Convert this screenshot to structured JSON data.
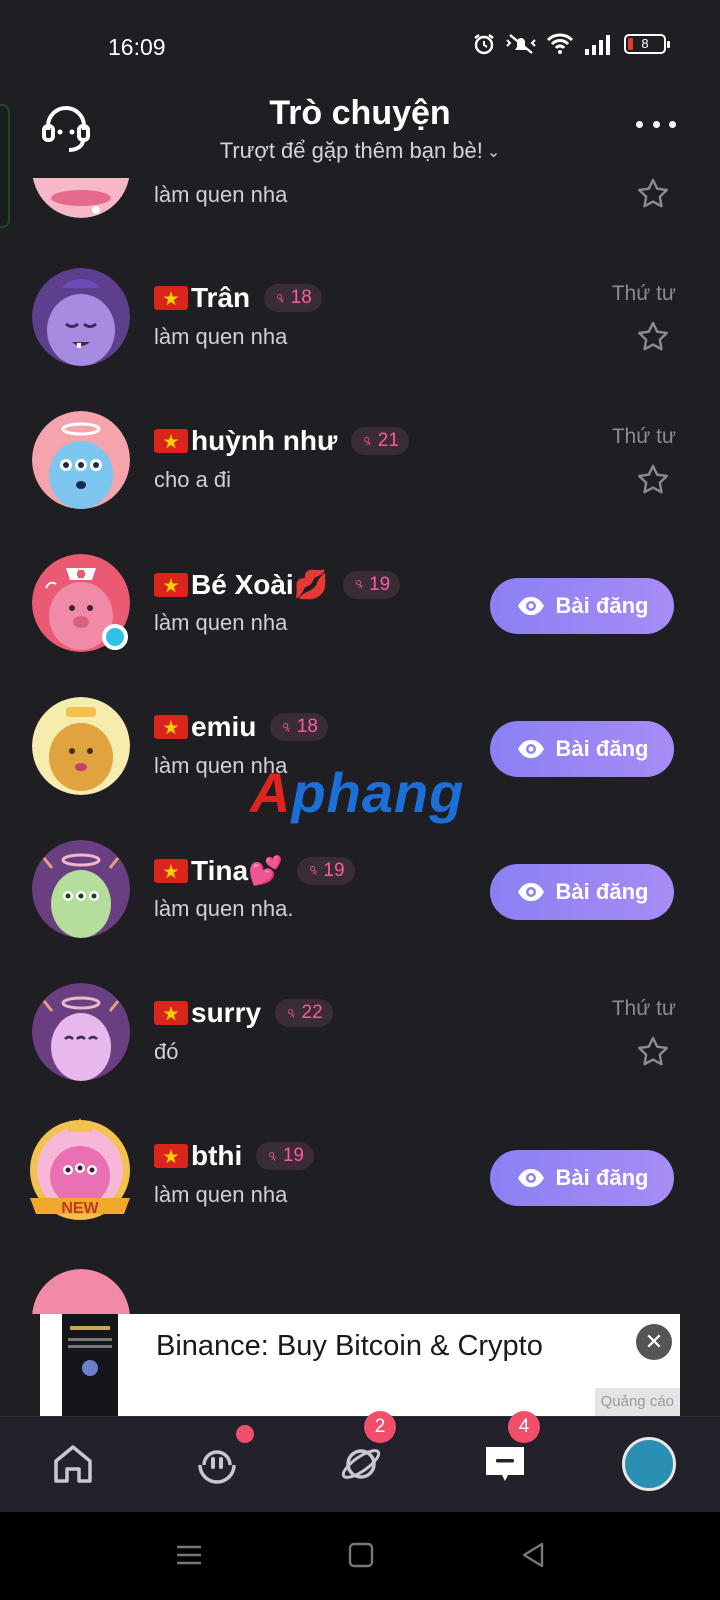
{
  "status_bar": {
    "time": "16:09",
    "battery": "8",
    "icons": [
      "alarm-icon",
      "mute-icon",
      "wifi-icon",
      "signal-icon",
      "battery-icon"
    ]
  },
  "header": {
    "title": "Trò chuyện",
    "subtitle": "Trượt để gặp thêm bạn bè!",
    "left_icon": "headset-support-icon",
    "right_icon": "more-icon"
  },
  "chats": [
    {
      "name": "",
      "age": "",
      "message": "làm quen nha",
      "time": "",
      "action": "star",
      "avatar": "pink-monster"
    },
    {
      "name": "Trân",
      "age": "18",
      "message": "làm quen nha",
      "time": "Thứ tư",
      "action": "star",
      "avatar": "purple-monster"
    },
    {
      "name": "huỳnh như",
      "age": "21",
      "message": "cho a đi",
      "time": "Thứ tư",
      "action": "star",
      "avatar": "blue-monster"
    },
    {
      "name": "Bé Xoài💋",
      "age": "19",
      "message": "làm quen nha",
      "time": "",
      "action": "post",
      "avatar": "pink-nurse-monster"
    },
    {
      "name": "emiu",
      "age": "18",
      "message": "làm quen nha",
      "time": "",
      "action": "post",
      "avatar": "orange-monster"
    },
    {
      "name": "Tina💕",
      "age": "19",
      "message": "làm quen nha.",
      "time": "",
      "action": "post",
      "avatar": "green-monster"
    },
    {
      "name": "surry",
      "age": "22",
      "message": "đó",
      "time": "Thứ tư",
      "action": "star",
      "avatar": "lilac-monster"
    },
    {
      "name": "bthi",
      "age": "19",
      "message": "làm quen nha",
      "time": "",
      "action": "post",
      "avatar": "pink-new-monster"
    }
  ],
  "labels": {
    "post_button": "Bài đăng",
    "new_badge": "NEW"
  },
  "watermark": {
    "part1": "A",
    "part2": "phang"
  },
  "ad": {
    "title": "Binance: Buy Bitcoin & Crypto",
    "label": "Quảng cáo",
    "close": "✕"
  },
  "bottom_nav": {
    "items": [
      "home-icon",
      "match-icon",
      "planet-icon",
      "chat-icon",
      "profile-avatar"
    ],
    "planet_badge": "2",
    "chat_badge": "4"
  },
  "colors": {
    "background": "#1f1e23",
    "accent": "#8b80f4",
    "age_badge": "#ff5aa0",
    "badge": "#f04e6a"
  }
}
